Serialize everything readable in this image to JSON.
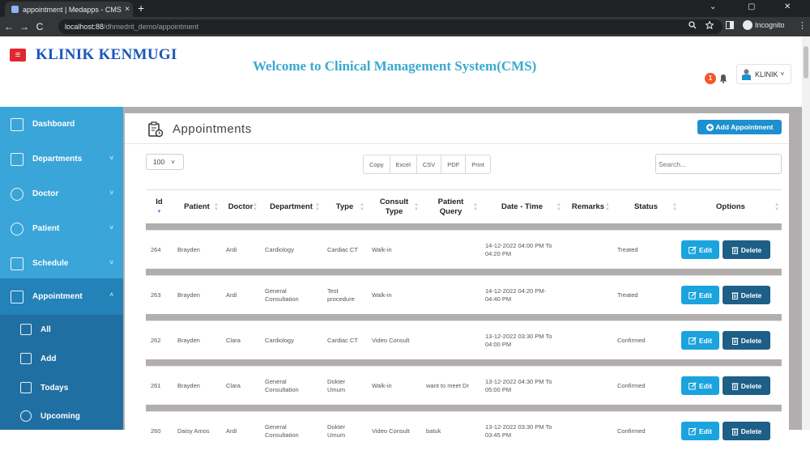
{
  "browser": {
    "tab_title": "appointment | Medapps - CMS",
    "tab_close": "×",
    "new_tab": "+",
    "url_host": "localhost:88",
    "url_path": "/dhmedrit_demo/appointment",
    "incognito_label": "Incognito",
    "win_min": "⌄",
    "win_restore": "▢",
    "win_close": "✕",
    "back": "←",
    "forward": "→",
    "reload": "C",
    "menu": "⋮"
  },
  "header": {
    "menu_icon": "≡",
    "brand": "KLINIK KENMUGI",
    "welcome": "Welcome to Clinical Management System(CMS)",
    "notification_count": "1",
    "user_label": "KLINIK",
    "user_caret": "˅"
  },
  "sidebar": {
    "items": [
      {
        "label": "Dashboard",
        "icon": "dashboard-icon",
        "chev": ""
      },
      {
        "label": "Departments",
        "icon": "departments-icon",
        "chev": "˅"
      },
      {
        "label": "Doctor",
        "icon": "doctor-icon",
        "chev": "˅"
      },
      {
        "label": "Patient",
        "icon": "patient-icon",
        "chev": "˅"
      },
      {
        "label": "Schedule",
        "icon": "schedule-icon",
        "chev": "˅"
      },
      {
        "label": "Appointment",
        "icon": "appointment-icon",
        "chev": "˄"
      }
    ],
    "subitems": [
      {
        "label": "All",
        "icon": "all-icon"
      },
      {
        "label": "Add",
        "icon": "add-icon"
      },
      {
        "label": "Todays",
        "icon": "calendar-check-icon"
      },
      {
        "label": "Upcoming",
        "icon": "upcoming-icon"
      }
    ]
  },
  "main": {
    "title": "Appointments",
    "add_button": "Add Appointment",
    "page_length": "100",
    "page_length_caret": "˅",
    "export_buttons": [
      "Copy",
      "Excel",
      "CSV",
      "PDF",
      "Print"
    ],
    "search_placeholder": "Search...",
    "columns": [
      "Id",
      "Patient",
      "Doctor",
      "Department",
      "Type",
      "Consult Type",
      "Patient Query",
      "Date - Time",
      "Remarks",
      "Status",
      "Options"
    ],
    "edit_label": "Edit",
    "delete_label": "Delete",
    "rows": [
      {
        "id": "264",
        "patient": "Brayden",
        "doctor": "Ardi",
        "department": "Cardiology",
        "type": "Cardiac CT",
        "consult": "Walk-in",
        "query": "",
        "datetime": "14-12-2022 04:00 PM To 04:20 PM",
        "remarks": "",
        "status": "Treated"
      },
      {
        "id": "263",
        "patient": "Brayden",
        "doctor": "Ardi",
        "department": "General Consultation",
        "type": "Test procedure",
        "consult": "Walk-in",
        "query": "",
        "datetime": "14-12-2022 04:20 PM-04:40 PM",
        "remarks": "",
        "status": "Treated"
      },
      {
        "id": "262",
        "patient": "Brayden",
        "doctor": "Clara",
        "department": "Cardiology",
        "type": "Cardiac CT",
        "consult": "Video Consult",
        "query": "",
        "datetime": "13-12-2022 03:30 PM To 04:00 PM",
        "remarks": "",
        "status": "Confirmed"
      },
      {
        "id": "261",
        "patient": "Brayden",
        "doctor": "Clara",
        "department": "General Consultation",
        "type": "Dokter Umum",
        "consult": "Walk-in",
        "query": "want to meet Dr",
        "datetime": "13-12-2022 04:30 PM To 05:00 PM",
        "remarks": "",
        "status": "Confirmed"
      },
      {
        "id": "260",
        "patient": "Daisy Amos",
        "doctor": "Ardi",
        "department": "General Consultation",
        "type": "Dokter Umum",
        "consult": "Video Consult",
        "query": "batuk",
        "datetime": "13-12-2022 03:30 PM To 03:45 PM",
        "remarks": "",
        "status": "Confirmed"
      }
    ]
  }
}
